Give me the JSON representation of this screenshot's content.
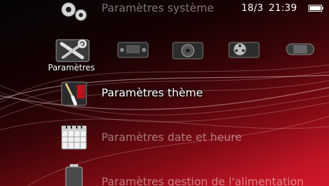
{
  "status_bar": {
    "date": "18/3",
    "time": "21:39"
  },
  "top_item": {
    "label": "Paramètres système",
    "icon": "gear-icon"
  },
  "categories": [
    {
      "label": "Paramètres",
      "icon": "toolbox-icon",
      "selected": true
    },
    {
      "label": "",
      "icon": "gamepad-icon"
    },
    {
      "label": "",
      "icon": "speaker-icon"
    },
    {
      "label": "",
      "icon": "film-reel-icon"
    },
    {
      "label": "",
      "icon": "psp-console-icon"
    }
  ],
  "items": [
    {
      "label": "Paramètres thème",
      "icon": "paint-brush-icon",
      "selected": true
    },
    {
      "label": "Paramètres date et heure",
      "icon": "calendar-icon"
    },
    {
      "label": "Paramètres gestion de l'alimentation",
      "icon": "battery-icon"
    }
  ],
  "colors": {
    "accent": "#d2182a",
    "background_dark": "#050505"
  }
}
